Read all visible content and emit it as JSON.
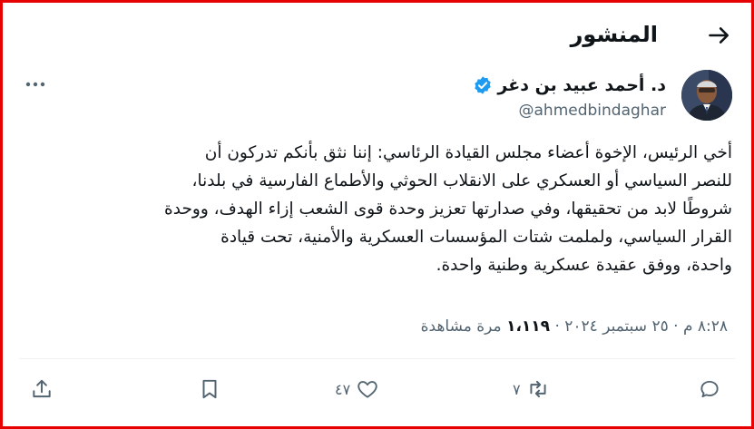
{
  "header": {
    "title": "المنشور",
    "back_icon": "arrow-right-icon"
  },
  "author": {
    "name": "د. أحمد عبيد بن دغر",
    "handle": "@ahmedbindaghar",
    "verified_icon": "verified-badge-icon",
    "verified_color": "#1d9bf0"
  },
  "tweet": {
    "text": "أخي الرئيس، الإخوة أعضاء مجلس القيادة الرئاسي: إننا نثق بأنكم تدركون أن\nللنصر السياسي أو العسكري على الانقلاب الحوثي والأطماع الفارسية في بلدنا،\nشروطًا لابد من تحقيقها، وفي صدارتها تعزيز وحدة قوى الشعب إزاء الهدف، ووحدة\nالقرار السياسي، ولملمت شتات المؤسسات العسكرية والأمنية، تحت قيادة\nواحدة، ووفق عقيدة عسكرية وطنية واحدة.",
    "time": "٨:٢٨ م",
    "date": "٢٥ سبتمبر ٢٠٢٤",
    "views_count": "١،١١٩",
    "views_label": "مرة مشاهدة",
    "separator": "·"
  },
  "actions": {
    "reply_icon": "reply-icon",
    "retweet_icon": "retweet-icon",
    "retweet_count": "٧",
    "like_icon": "heart-icon",
    "like_count": "٤٧",
    "bookmark_icon": "bookmark-icon",
    "share_icon": "share-icon"
  },
  "colors": {
    "text": "#0f1419",
    "muted": "#536471",
    "accent": "#1d9bf0",
    "frame": "#e60000"
  }
}
